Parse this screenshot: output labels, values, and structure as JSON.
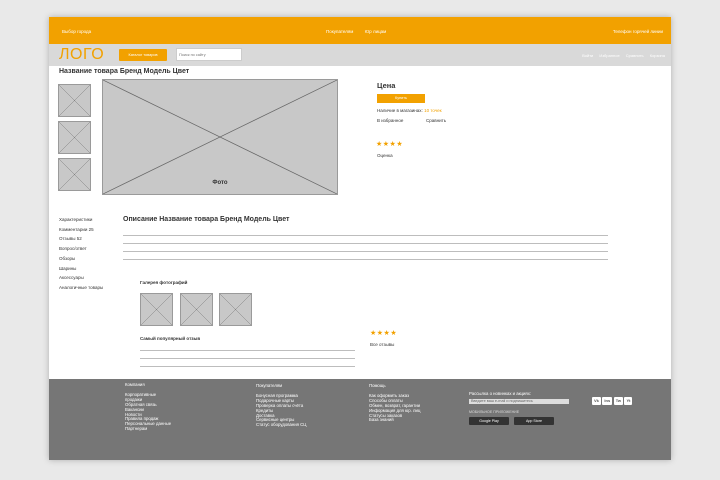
{
  "topbar": {
    "city": "Выбор города",
    "nav": [
      "Покупателям",
      "Юр лицам"
    ],
    "hotline": "Телефон горячей линии"
  },
  "header": {
    "logo": "ЛОГО",
    "catalog_button": "Каталог товаров",
    "search_placeholder": "Поиск по сайту",
    "user_links": [
      "Войти",
      "Избранное",
      "Сравнить",
      "Корзина"
    ]
  },
  "product": {
    "title": "Название товара Бренд Модель Цвет",
    "photo_label": "Фото",
    "thumbnail_count": 3
  },
  "buy_box": {
    "price_label": "Цена",
    "buy_button": "Купить",
    "availability_label": "Наличие в магазинах:",
    "availability_count": "10 точек",
    "favorite": "В избранное",
    "compare": "Сравнить",
    "stars": "★★★★",
    "rating_value": 4,
    "rating_label": "Оценка"
  },
  "side_menu": [
    "Характеристики",
    "Комментарии  25",
    "Отзывы  52",
    "Вопрос/ответ",
    "Обзоры",
    "Шарины",
    "Аксессуары",
    "Аналогичные товары"
  ],
  "description": {
    "title": "Описание Название товара Бренд Модель Цвет",
    "gallery_title": "Галерея фотографий",
    "gallery_count": 3,
    "popular_review_title": "Самый популярный отзыв",
    "review_stars": "★★★★",
    "review_rating": 4,
    "all_reviews": "Все отзывы"
  },
  "footer": {
    "columns": [
      {
        "title": "Компания",
        "items": [
          "Корпоративные",
          "продажи",
          "Обратная связь",
          "Вакансии",
          "Новости",
          "Правила продаж",
          "Персональные данные",
          "Партнерам"
        ]
      },
      {
        "title": "Покупателям",
        "items": [
          "Бонусная программа",
          "Подарочные карты",
          "Проверка оплаты счёта",
          "Кредиты",
          "Доставка",
          "Сервисные центры",
          "Статус оборудования СЦ"
        ]
      },
      {
        "title": "Помощь",
        "items": [
          "Как оформить заказ",
          "Способы оплаты",
          "Обмен, возврат, гарантии",
          "Информация для юр. лиц",
          "Статусы заказов",
          "База знаний"
        ]
      }
    ],
    "subscribe_label": "Рассылка о новинках и акциях:",
    "subscribe_placeholder": "Введите ваш e-mail и подпишитесь",
    "mobile_label": "МОБИЛЬНОЕ ПРИЛОЖЕНИЕ",
    "stores": [
      "Google Play",
      "App Store"
    ],
    "social": [
      "Vk",
      "Ins",
      "Tw",
      "Yt"
    ]
  },
  "colors": {
    "accent": "#f2a100",
    "header_gray": "#d9d9d9",
    "footer_gray": "#767676",
    "placeholder_gray": "#c8c8c8"
  }
}
